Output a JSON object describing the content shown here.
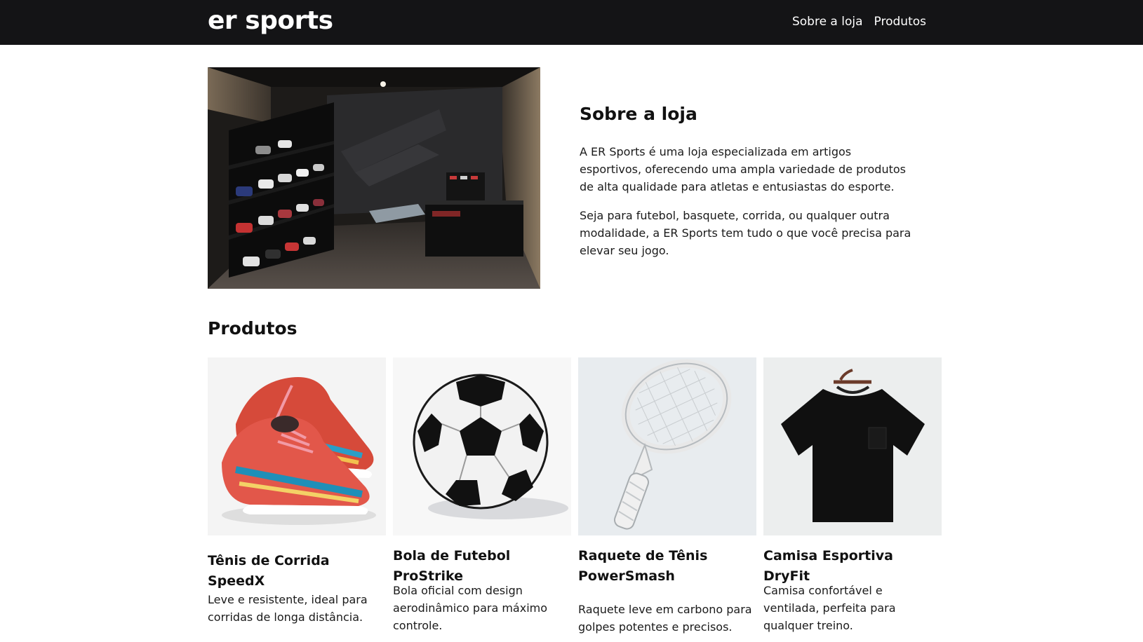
{
  "header": {
    "brand": "er sports",
    "nav": [
      "Sobre a loja",
      "Produtos"
    ]
  },
  "about": {
    "title": "Sobre a loja",
    "image": "store-interior-photo",
    "paragraphs": [
      "A ER Sports é uma loja especializada em artigos esportivos, oferecendo uma ampla variedade de produtos de alta qualidade para atletas e entusiastas do esporte.",
      "Seja para futebol, basquete, corrida, ou qualquer outra modalidade, a ER Sports tem tudo o que você precisa para elevar seu jogo."
    ]
  },
  "products": {
    "title": "Produtos",
    "items": [
      {
        "name": "Tênis de Corrida SpeedX",
        "description": "Leve e resistente, ideal para corridas de longa distância.",
        "image": "running-shoes-photo"
      },
      {
        "name": "Bola de Futebol ProStrike",
        "description": "Bola oficial com design aerodinâmico para máximo controle.",
        "image": "soccer-ball-photo"
      },
      {
        "name": "Raquete de Tênis PowerSmash",
        "description": "Raquete leve em carbono para golpes potentes e precisos.",
        "image": "tennis-racket-photo"
      },
      {
        "name": "Camisa Esportiva DryFit",
        "description": "Camisa confortável e ventilada, perfeita para qualquer treino.",
        "image": "tshirt-photo"
      }
    ]
  },
  "colors": {
    "navbar_bg": "#141416",
    "text": "#111111",
    "background": "#ffffff"
  }
}
